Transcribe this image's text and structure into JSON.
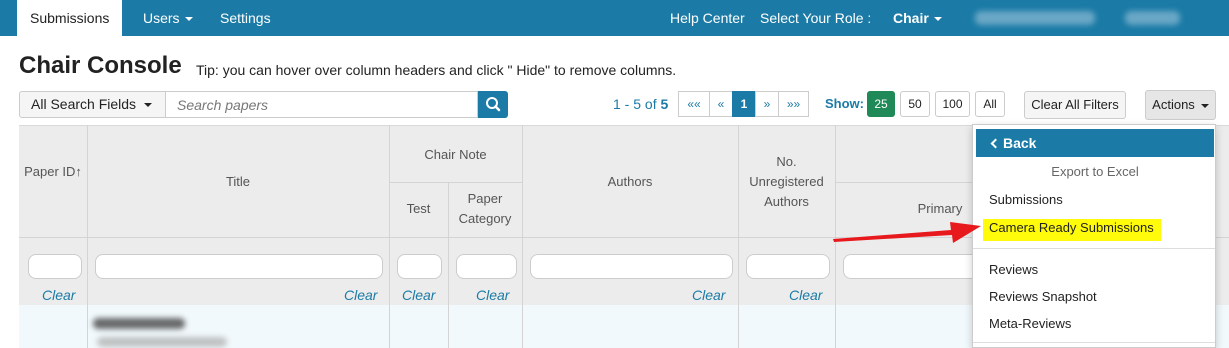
{
  "nav": {
    "submissions": "Submissions",
    "users": "Users",
    "settings": "Settings",
    "help_center": "Help Center",
    "select_role": "Select Your Role :",
    "role": "Chair"
  },
  "page": {
    "title": "Chair Console",
    "tip": "Tip: you can hover over column headers and click \" Hide\" to remove columns."
  },
  "search": {
    "field_label": "All Search Fields",
    "placeholder": "Search papers"
  },
  "pagination": {
    "range_text": "1 - 5 of ",
    "total": "5",
    "buttons": [
      "««",
      "«",
      "1",
      "»",
      "»»"
    ],
    "current": "1"
  },
  "show": {
    "label": "Show:",
    "options": [
      "25",
      "50",
      "100",
      "All"
    ],
    "selected": "25"
  },
  "toolbar": {
    "clear_all": "Clear All Filters",
    "actions": "Actions"
  },
  "table": {
    "headers": {
      "paper_id": "Paper ID",
      "paper_id_sort": "↑",
      "title": "Title",
      "chair_note": "Chair Note",
      "test": "Test",
      "paper_category_1": "Paper",
      "paper_category_2": "Category",
      "authors": "Authors",
      "no_1": "No.",
      "no_2": "Unregistered",
      "no_3": "Authors",
      "primary": "Primary"
    },
    "clear_label": "Clear"
  },
  "menu": {
    "back": "Back",
    "header": "Export to Excel",
    "items": [
      "Submissions",
      "Camera Ready Submissions",
      "Reviews",
      "Reviews Snapshot",
      "Meta-Reviews"
    ]
  },
  "colors": {
    "primary": "#1b7ba6",
    "highlight": "#fffb0a",
    "arrow": "#e8191c",
    "show_selected": "#1f8a57"
  }
}
